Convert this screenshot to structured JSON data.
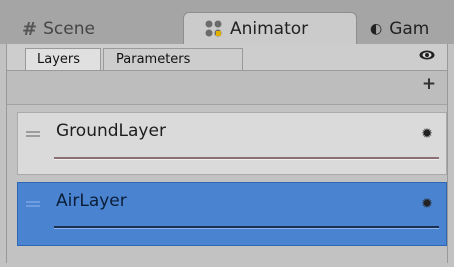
{
  "window_tabs": [
    {
      "label": "Scene",
      "icon": "hash-icon"
    },
    {
      "label": "Animator",
      "icon": "animator-icon"
    },
    {
      "label": "Gam",
      "icon": "game-icon"
    }
  ],
  "panel": {
    "sub_tabs": [
      "Layers",
      "Parameters"
    ],
    "eye_icon": "eye-icon",
    "add_label": "+"
  },
  "layers": [
    {
      "name": "GroundLayer",
      "selected": false
    },
    {
      "name": "AirLayer",
      "selected": true
    }
  ],
  "colors": {
    "selected": "#4a83d0",
    "ground_bg": "#dadada",
    "panel_bg": "#c2c2c2"
  }
}
